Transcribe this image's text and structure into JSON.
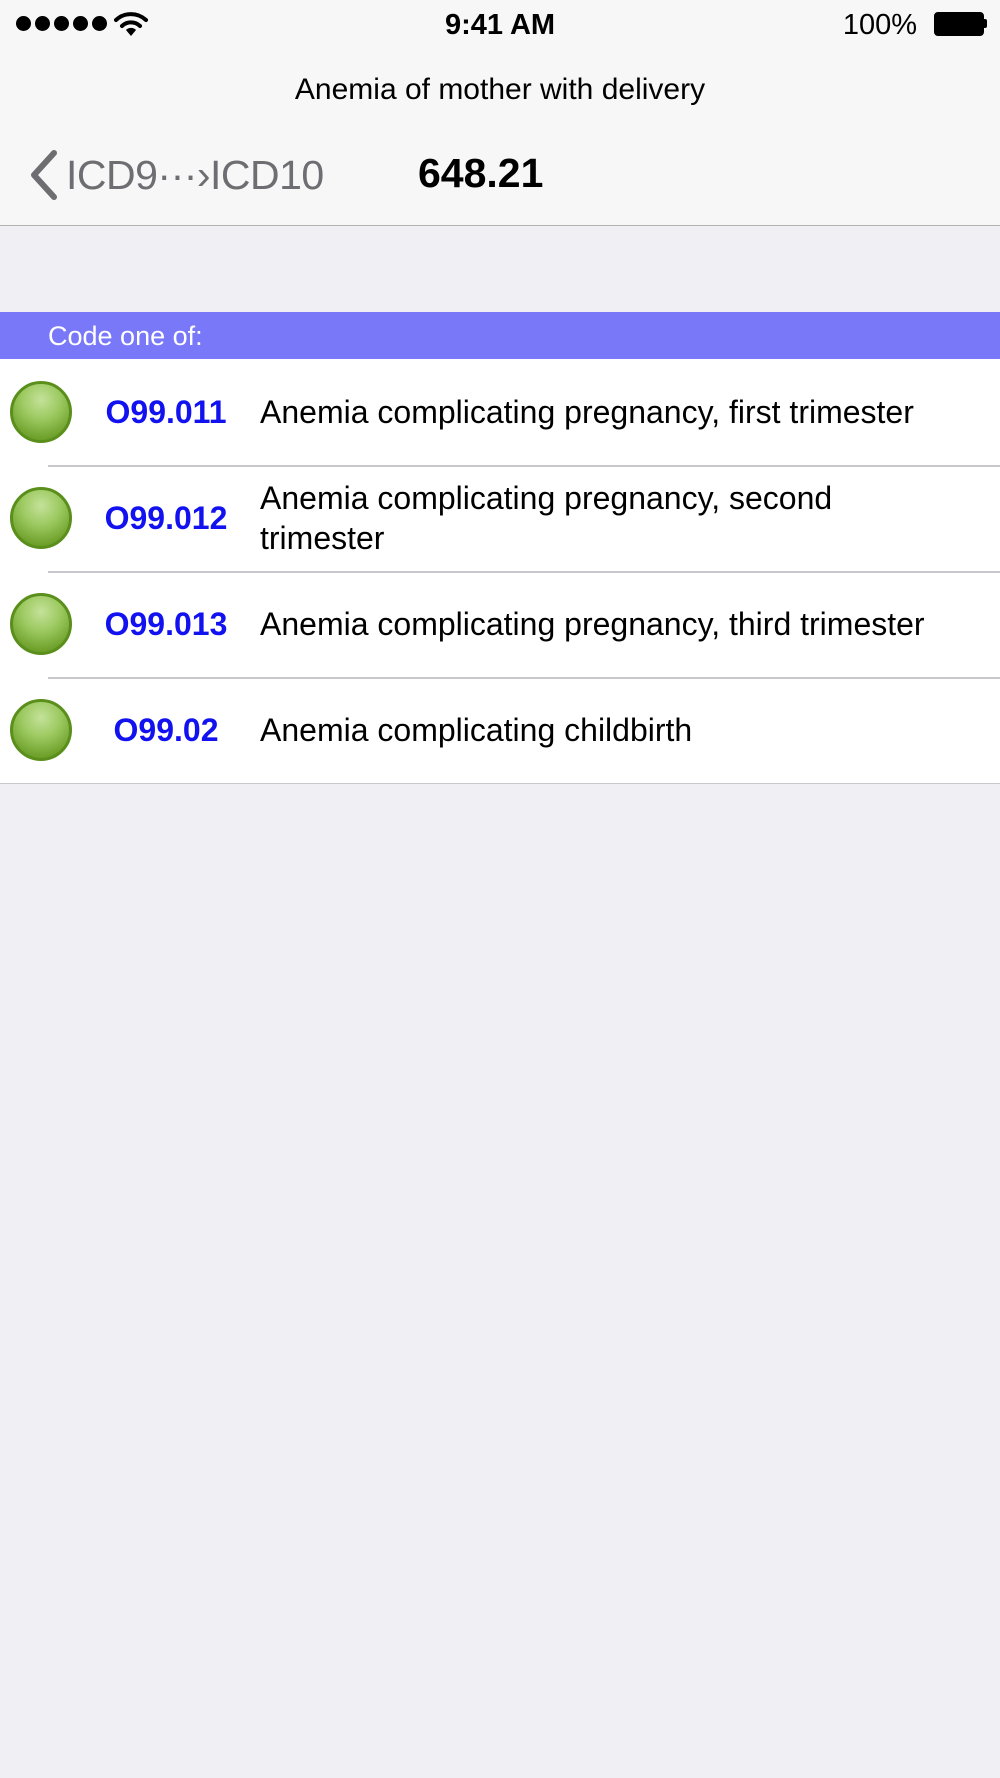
{
  "status_bar": {
    "time": "9:41 AM",
    "battery_percent": "100%",
    "signal_bars": 5,
    "icons": [
      "signal-dots",
      "wifi-icon",
      "battery-icon"
    ]
  },
  "nav": {
    "prompt": "Anemia of mother with delivery",
    "back_label": "ICD9···›ICD10",
    "title": "648.21",
    "back_icon": "chevron-left-icon"
  },
  "section": {
    "header": "Code one of:"
  },
  "rows": [
    {
      "code": "O99.011",
      "description": "Anemia complicating pregnancy, first trimester",
      "status_icon": "green-status-icon"
    },
    {
      "code": "O99.012",
      "description": "Anemia complicating pregnancy, second trimester",
      "status_icon": "green-status-icon"
    },
    {
      "code": "O99.013",
      "description": "Anemia complicating pregnancy, third trimester",
      "status_icon": "green-status-icon"
    },
    {
      "code": "O99.02",
      "description": "Anemia complicating childbirth",
      "status_icon": "green-status-icon"
    }
  ],
  "colors": {
    "section_header_bg": "#7878f8",
    "code_text": "#1212f0",
    "status_green": "#7fb03c",
    "back_text": "#6d6d72",
    "background": "#efeff4"
  }
}
